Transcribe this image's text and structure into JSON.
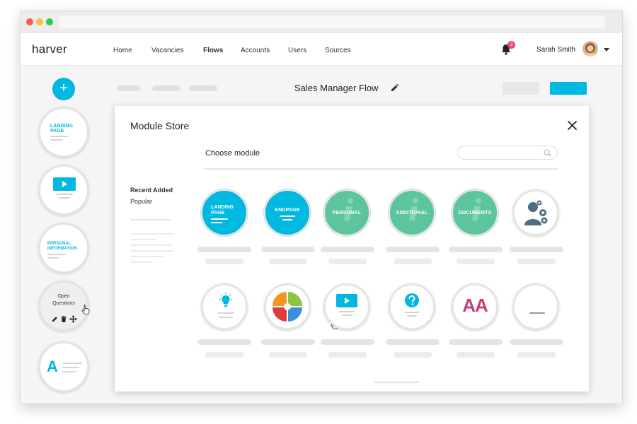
{
  "app": {
    "logo": "harver"
  },
  "nav": {
    "items": [
      {
        "label": "Home"
      },
      {
        "label": "Vacancies"
      },
      {
        "label": "Flows"
      },
      {
        "label": "Accounts"
      },
      {
        "label": "Users"
      },
      {
        "label": "Sources"
      }
    ],
    "active": "Flows"
  },
  "user": {
    "name": "Sarah Smith",
    "notification_count": "3"
  },
  "flow": {
    "title": "Sales Manager Flow"
  },
  "sidebar": {
    "add_label": "+",
    "items": [
      {
        "label_line1": "LANDING",
        "label_line2": "PAGE"
      },
      {
        "icon": "video-icon"
      },
      {
        "label_line1": "PERSONAL",
        "label_line2": "INFORMATION"
      },
      {
        "label_line1": "Open",
        "label_line2": "Questions"
      },
      {
        "icon": "text-icon",
        "glyph": "A"
      }
    ]
  },
  "modal": {
    "title": "Module Store",
    "choose_label": "Choose module",
    "search_placeholder": "",
    "categories": [
      "Recent Added",
      "Popular"
    ]
  },
  "modules": {
    "landing_l1": "LANDING",
    "landing_l2": "PAGE",
    "endpage": "ENDPAGE",
    "personal": "PERSONAL",
    "additional": "ADDITIONAL",
    "documents": "DOCUMENTS",
    "font_glyph": "AA"
  },
  "colors": {
    "accent": "#00b8e0",
    "green": "#5cc59e",
    "badge": "#e9496b",
    "pink": "#c2407a"
  }
}
